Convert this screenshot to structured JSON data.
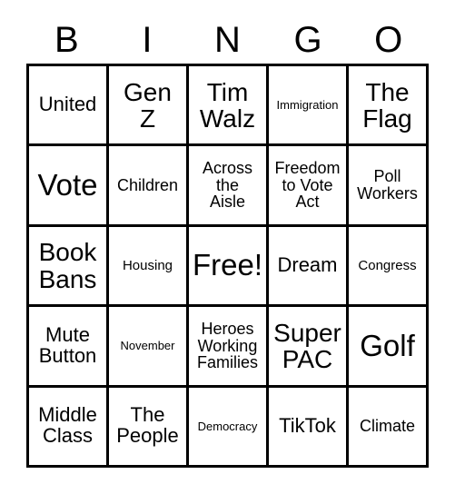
{
  "header": {
    "letters": [
      "B",
      "I",
      "N",
      "G",
      "O"
    ]
  },
  "grid": {
    "rows": [
      [
        {
          "text": "United",
          "size": "fs-md"
        },
        {
          "text": "Gen\nZ",
          "size": "fs-lg"
        },
        {
          "text": "Tim\nWalz",
          "size": "fs-lg"
        },
        {
          "text": "Immigration",
          "size": "fs-xxs"
        },
        {
          "text": "The\nFlag",
          "size": "fs-lg"
        }
      ],
      [
        {
          "text": "Vote",
          "size": "fs-xl"
        },
        {
          "text": "Children",
          "size": "fs-sm"
        },
        {
          "text": "Across\nthe\nAisle",
          "size": "fs-sm"
        },
        {
          "text": "Freedom\nto Vote\nAct",
          "size": "fs-sm"
        },
        {
          "text": "Poll\nWorkers",
          "size": "fs-sm"
        }
      ],
      [
        {
          "text": "Book\nBans",
          "size": "fs-lg"
        },
        {
          "text": "Housing",
          "size": "fs-xs"
        },
        {
          "text": "Free!",
          "size": "fs-xl"
        },
        {
          "text": "Dream",
          "size": "fs-md"
        },
        {
          "text": "Congress",
          "size": "fs-xs"
        }
      ],
      [
        {
          "text": "Mute\nButton",
          "size": "fs-md"
        },
        {
          "text": "November",
          "size": "fs-xxs"
        },
        {
          "text": "Heroes\nWorking\nFamilies",
          "size": "fs-sm"
        },
        {
          "text": "Super\nPAC",
          "size": "fs-lg"
        },
        {
          "text": "Golf",
          "size": "fs-xl"
        }
      ],
      [
        {
          "text": "Middle\nClass",
          "size": "fs-md"
        },
        {
          "text": "The\nPeople",
          "size": "fs-md"
        },
        {
          "text": "Democracy",
          "size": "fs-xxs"
        },
        {
          "text": "TikTok",
          "size": "fs-md"
        },
        {
          "text": "Climate",
          "size": "fs-sm"
        }
      ]
    ]
  }
}
